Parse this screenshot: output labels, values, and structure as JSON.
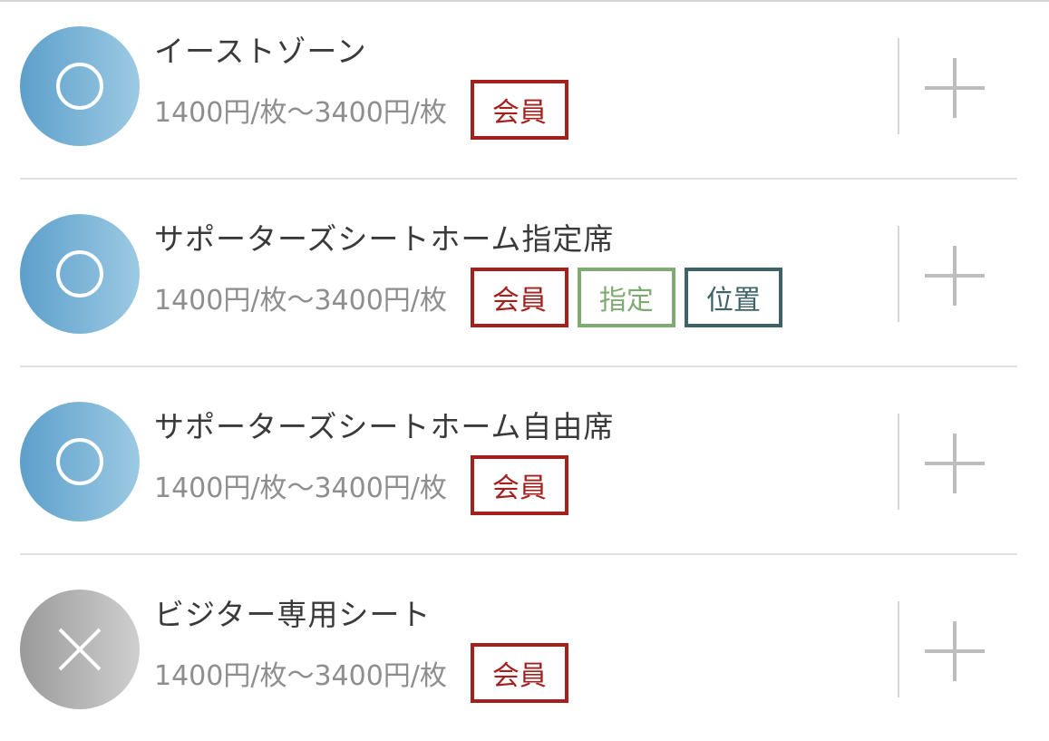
{
  "seats": [
    {
      "name": "イーストゾーン",
      "price": "1400円/枚〜3400円/枚",
      "status": "available",
      "status_icon": "circle-icon",
      "badges": [
        "会員"
      ]
    },
    {
      "name": "サポーターズシートホーム指定席",
      "price": "1400円/枚〜3400円/枚",
      "status": "available",
      "status_icon": "circle-icon",
      "badges": [
        "会員",
        "指定",
        "位置"
      ]
    },
    {
      "name": "サポーターズシートホーム自由席",
      "price": "1400円/枚〜3400円/枚",
      "status": "available",
      "status_icon": "circle-icon",
      "badges": [
        "会員"
      ]
    },
    {
      "name": "ビジター専用シート",
      "price": "1400円/枚〜3400円/枚",
      "status": "soldout",
      "status_icon": "cross-icon",
      "badges": [
        "会員"
      ]
    }
  ],
  "colors": {
    "member_badge": "#a3201d",
    "reserved_badge": "#7fab73",
    "position_badge": "#3e6367",
    "available_gradient": [
      "#5d9fcb",
      "#9ccae3"
    ],
    "soldout_gradient": [
      "#9a9a9a",
      "#cfcfcf"
    ]
  },
  "add_icon": "plus-icon"
}
